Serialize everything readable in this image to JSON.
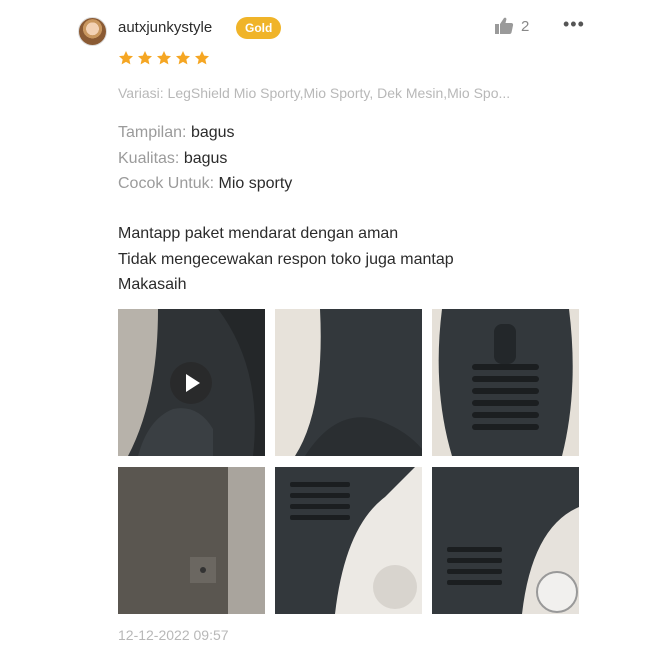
{
  "colors": {
    "badge_bg": "#f0b429",
    "star": "#f5a623",
    "accent": "#ee4d2d"
  },
  "review": {
    "username": "autxjunkystyle",
    "badge": "Gold",
    "like_count": "2",
    "more_icon": "more-horizontal-icon",
    "rating": 5,
    "variation": "Variasi: LegShield Mio Sporty,Mio Sporty, Dek Mesin,Mio Spo...",
    "attributes": [
      {
        "label": "Tampilan:",
        "value": "bagus"
      },
      {
        "label": "Kualitas:",
        "value": "bagus"
      },
      {
        "label": "Cocok Untuk:",
        "value": "Mio sporty"
      }
    ],
    "comment_lines": [
      "Mantapp paket mendarat dengan aman",
      "Tidak mengecewakan respon toko juga mantap",
      "Makasaih"
    ],
    "media": [
      {
        "type": "video",
        "icon": "play-icon"
      },
      {
        "type": "image"
      },
      {
        "type": "image"
      },
      {
        "type": "image"
      },
      {
        "type": "image"
      },
      {
        "type": "image"
      }
    ],
    "timestamp": "12-12-2022 09:57"
  }
}
